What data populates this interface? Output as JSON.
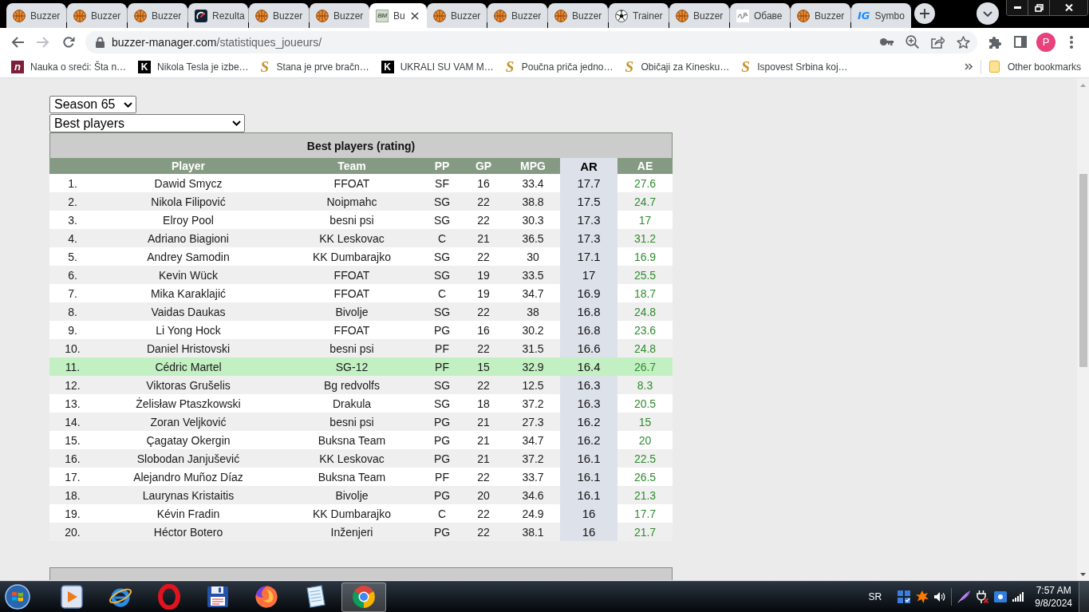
{
  "browser": {
    "tabs": [
      {
        "title": "Buzzer",
        "kind": "basketball",
        "selected": false
      },
      {
        "title": "Buzzer",
        "kind": "basketball",
        "selected": false
      },
      {
        "title": "Buzzer",
        "kind": "basketball",
        "selected": false
      },
      {
        "title": "Rezulta",
        "kind": "scores",
        "selected": false
      },
      {
        "title": "Buzzer",
        "kind": "basketball",
        "selected": false
      },
      {
        "title": "Buzzer",
        "kind": "basketball",
        "selected": false
      },
      {
        "title": "Bu",
        "kind": "monogram",
        "glyph": "BM",
        "selected": true
      },
      {
        "title": "Buzzer",
        "kind": "basketball",
        "selected": false
      },
      {
        "title": "Buzzer",
        "kind": "basketball",
        "selected": false
      },
      {
        "title": "Buzzer",
        "kind": "basketball",
        "selected": false
      },
      {
        "title": "Trainer",
        "kind": "ball",
        "selected": false
      },
      {
        "title": "Buzzer",
        "kind": "basketball",
        "selected": false
      },
      {
        "title": "Обаве",
        "kind": "script",
        "selected": false
      },
      {
        "title": "Buzzer",
        "kind": "basketball",
        "selected": false
      },
      {
        "title": "Symbo",
        "kind": "lettermark",
        "glyph": "IG",
        "selected": false
      }
    ],
    "address": {
      "domain": "buzzer-manager.com",
      "path": "/statistiques_joueurs/"
    },
    "profile_initial": "P",
    "bookmarks": [
      {
        "title": "Nauka o sreći: Šta n…",
        "kind": "tile",
        "glyph": "n"
      },
      {
        "title": "Nikola Tesla je izbe…",
        "kind": "dark-tile",
        "glyph": "K"
      },
      {
        "title": "Stana je prve bračn…",
        "kind": "script-letter",
        "glyph": "S"
      },
      {
        "title": "UKRALI SU VAM M…",
        "kind": "dark-tile",
        "glyph": "K"
      },
      {
        "title": "Poučna priča jedno…",
        "kind": "script-letter",
        "glyph": "S"
      },
      {
        "title": "Običaji za Kinesku…",
        "kind": "script-letter",
        "glyph": "S"
      },
      {
        "title": "Ispovest Srbina koj…",
        "kind": "script-letter",
        "glyph": "S"
      }
    ],
    "other_bookmarks": "Other bookmarks"
  },
  "page": {
    "season_select": {
      "value": "Season 65"
    },
    "view_select": {
      "value": "Best players"
    },
    "table": {
      "title": "Best players (rating)",
      "columns": [
        {
          "label": "Player",
          "sorted": false
        },
        {
          "label": "Team",
          "sorted": false
        },
        {
          "label": "PP",
          "sorted": false
        },
        {
          "label": "GP",
          "sorted": false
        },
        {
          "label": "MPG",
          "sorted": false
        },
        {
          "label": "AR",
          "sorted": true
        },
        {
          "label": "AE",
          "sorted": false
        }
      ],
      "rows": [
        {
          "rank": "1.",
          "cells": [
            "Dawid Smycz",
            "FFOAT",
            "SF",
            "16",
            "33.4",
            "17.7",
            "27.6"
          ],
          "highlighted": false
        },
        {
          "rank": "2.",
          "cells": [
            "Nikola Filipović",
            "Noipmahc",
            "SG",
            "22",
            "38.8",
            "17.5",
            "24.7"
          ],
          "highlighted": false
        },
        {
          "rank": "3.",
          "cells": [
            "Elroy Pool",
            "besni psi",
            "SG",
            "22",
            "30.3",
            "17.3",
            "17"
          ],
          "highlighted": false
        },
        {
          "rank": "4.",
          "cells": [
            "Adriano Biagioni",
            "KK Leskovac",
            "C",
            "21",
            "36.5",
            "17.3",
            "31.2"
          ],
          "highlighted": false
        },
        {
          "rank": "5.",
          "cells": [
            "Andrey Samodin",
            "KK Dumbarajko",
            "SG",
            "22",
            "30",
            "17.1",
            "16.9"
          ],
          "highlighted": false
        },
        {
          "rank": "6.",
          "cells": [
            "Kevin Wück",
            "FFOAT",
            "SG",
            "19",
            "33.5",
            "17",
            "25.5"
          ],
          "highlighted": false
        },
        {
          "rank": "7.",
          "cells": [
            "Mika Karaklajić",
            "FFOAT",
            "C",
            "19",
            "34.7",
            "16.9",
            "18.7"
          ],
          "highlighted": false
        },
        {
          "rank": "8.",
          "cells": [
            "Vaidas Daukas",
            "Bivolje",
            "SG",
            "22",
            "38",
            "16.8",
            "24.8"
          ],
          "highlighted": false
        },
        {
          "rank": "9.",
          "cells": [
            "Li Yong Hock",
            "FFOAT",
            "PG",
            "16",
            "30.2",
            "16.8",
            "23.6"
          ],
          "highlighted": false
        },
        {
          "rank": "10.",
          "cells": [
            "Daniel Hristovski",
            "besni psi",
            "PF",
            "22",
            "31.5",
            "16.6",
            "24.8"
          ],
          "highlighted": false
        },
        {
          "rank": "11.",
          "cells": [
            "Cédric Martel",
            "SG-12",
            "PF",
            "15",
            "32.9",
            "16.4",
            "26.7"
          ],
          "highlighted": true
        },
        {
          "rank": "12.",
          "cells": [
            "Viktoras Grušelis",
            "Bg redvolfs",
            "SG",
            "22",
            "12.5",
            "16.3",
            "8.3"
          ],
          "highlighted": false
        },
        {
          "rank": "13.",
          "cells": [
            "Żelisław Ptaszkowski",
            "Drakula",
            "SG",
            "18",
            "37.2",
            "16.3",
            "20.5"
          ],
          "highlighted": false
        },
        {
          "rank": "14.",
          "cells": [
            "Zoran Veljković",
            "besni psi",
            "PG",
            "21",
            "27.3",
            "16.2",
            "15"
          ],
          "highlighted": false
        },
        {
          "rank": "15.",
          "cells": [
            "Çagatay Okergin",
            "Buksna Team",
            "PG",
            "21",
            "34.7",
            "16.2",
            "20"
          ],
          "highlighted": false
        },
        {
          "rank": "16.",
          "cells": [
            "Slobodan Janjušević",
            "KK Leskovac",
            "PG",
            "21",
            "37.2",
            "16.1",
            "22.5"
          ],
          "highlighted": false
        },
        {
          "rank": "17.",
          "cells": [
            "Alejandro Muñoz Díaz",
            "Buksna Team",
            "PF",
            "22",
            "33.7",
            "16.1",
            "26.5"
          ],
          "highlighted": false
        },
        {
          "rank": "18.",
          "cells": [
            "Laurynas Kristaitis",
            "Bivolje",
            "PG",
            "20",
            "34.6",
            "16.1",
            "21.3"
          ],
          "highlighted": false
        },
        {
          "rank": "19.",
          "cells": [
            "Kévin Fradin",
            "KK Dumbarajko",
            "C",
            "22",
            "24.9",
            "16",
            "17.7"
          ],
          "highlighted": false
        },
        {
          "rank": "20.",
          "cells": [
            "Héctor Botero",
            "Inženjeri",
            "PG",
            "22",
            "38.1",
            "16",
            "21.7"
          ],
          "highlighted": false
        }
      ]
    }
  },
  "taskbar": {
    "apps": [
      {
        "kind": "media",
        "selected": false
      },
      {
        "kind": "swoosh",
        "selected": false
      },
      {
        "kind": "ring",
        "selected": false
      },
      {
        "kind": "floppy",
        "selected": false
      },
      {
        "kind": "flame",
        "selected": false
      },
      {
        "kind": "notepad",
        "selected": false
      },
      {
        "kind": "segments",
        "selected": true
      }
    ],
    "language": "SR",
    "time": "7:57 AM",
    "date": "9/8/2024"
  }
}
